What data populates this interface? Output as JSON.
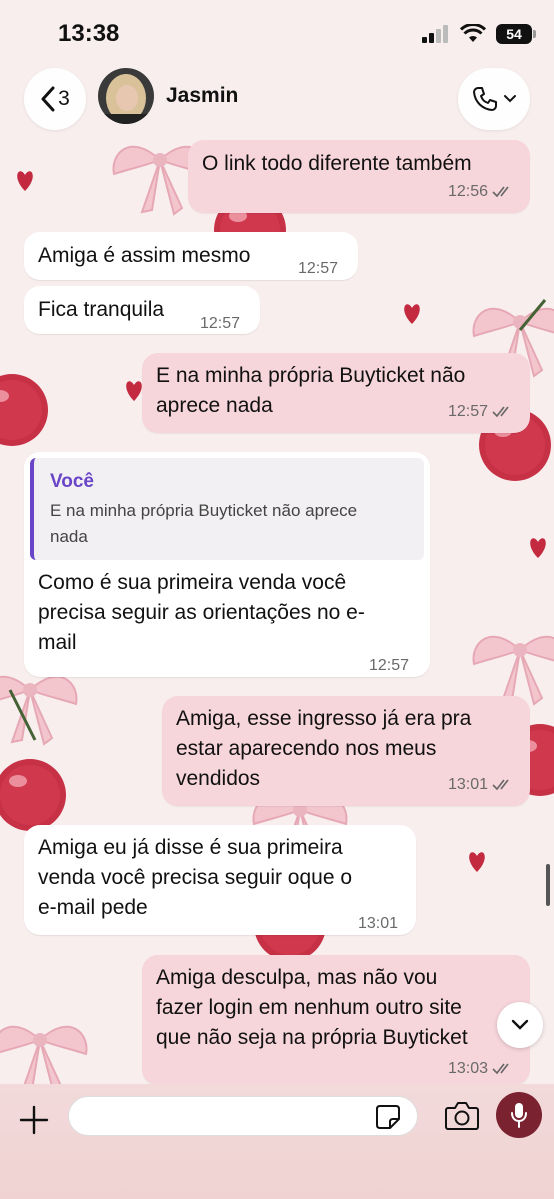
{
  "status_bar": {
    "time": "13:38",
    "battery": "54"
  },
  "header": {
    "back_count": "3",
    "contact_name": "Jasmin"
  },
  "messages": [
    {
      "direction": "out",
      "text": "O link todo diferente também",
      "time": "12:56",
      "read": true
    },
    {
      "direction": "in",
      "text": "Amiga é assim mesmo",
      "time": "12:57"
    },
    {
      "direction": "in",
      "text": "Fica tranquila",
      "time": "12:57"
    },
    {
      "direction": "out",
      "text": "E na minha própria Buyticket não\naprece nada",
      "time": "12:57",
      "read": true
    },
    {
      "direction": "in",
      "quote": {
        "author": "Você",
        "text": "E na minha própria Buyticket não aprece\nnada"
      },
      "text": "Como é sua primeira venda você\nprecisa seguir as orientações no e-\nmail",
      "time": "12:57"
    },
    {
      "direction": "out",
      "text": "Amiga, esse ingresso já era pra\nestar aparecendo nos meus\nvendidos",
      "time": "13:01",
      "read": true
    },
    {
      "direction": "in",
      "text": "Amiga eu já disse é sua primeira\nvenda você precisa seguir oque o\ne-mail pede",
      "time": "13:01"
    },
    {
      "direction": "out",
      "text": "Amiga desculpa, mas não vou\nfazer login em nenhum outro site\nque não seja na própria Buyticket",
      "time": "13:03",
      "read": true
    }
  ],
  "composer": {
    "placeholder": ""
  },
  "colors": {
    "outgoing_bubble": "#f6d5db",
    "incoming_bubble": "#ffffff",
    "quote_accent": "#6a45c8",
    "mic_button": "#7a2230"
  },
  "icons": [
    "chevron-left-icon",
    "phone-icon",
    "chevron-down-icon",
    "plus-icon",
    "sticker-icon",
    "camera-icon",
    "microphone-icon",
    "double-check-icon"
  ]
}
